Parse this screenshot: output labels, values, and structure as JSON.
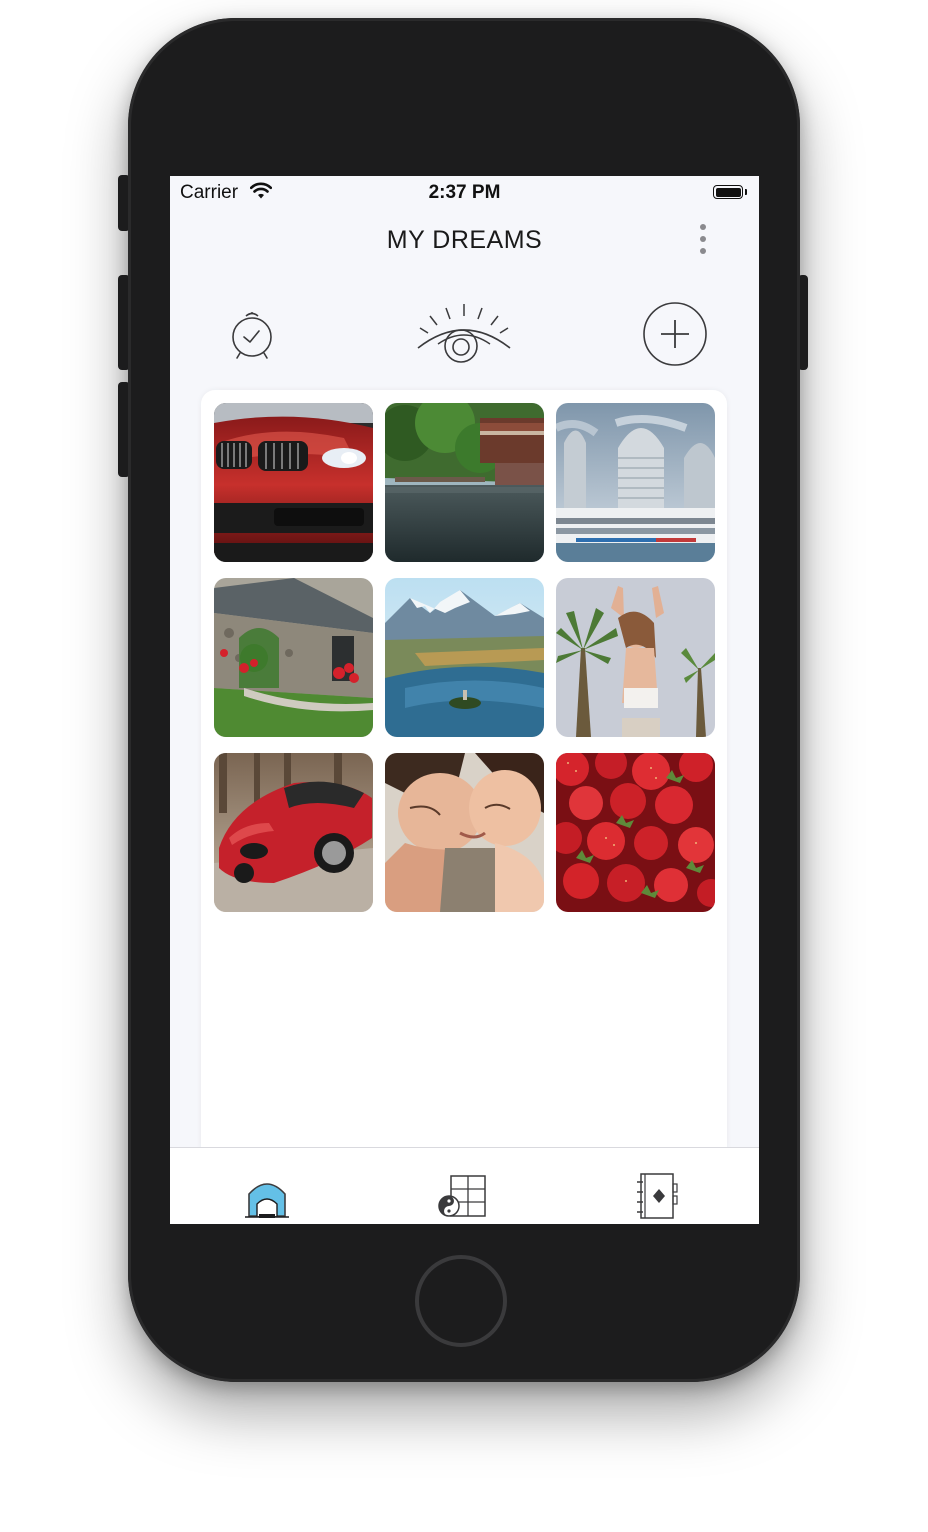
{
  "status_bar": {
    "carrier": "Carrier",
    "time": "2:37 PM",
    "wifi_icon": "wifi-icon",
    "battery_icon": "battery-icon"
  },
  "nav": {
    "title": "MY DREAMS",
    "more_icon": "more-vertical-icon"
  },
  "toolbar": {
    "alarm_icon": "alarm-clock-icon",
    "eye_icon": "eye-icon",
    "add_icon": "add-circle-icon"
  },
  "dream_images": [
    {
      "name": "red-bmw-car"
    },
    {
      "name": "lake-house"
    },
    {
      "name": "city-towers-cruise-ship"
    },
    {
      "name": "stone-cottage-flowers"
    },
    {
      "name": "mountain-lake-island"
    },
    {
      "name": "woman-stretching-palms"
    },
    {
      "name": "red-sports-car"
    },
    {
      "name": "couple-embracing"
    },
    {
      "name": "strawberries"
    }
  ],
  "tab_bar": {
    "tabs": [
      {
        "icon": "home-icon",
        "active": true
      },
      {
        "icon": "vision-board-icon",
        "active": false
      },
      {
        "icon": "journal-icon",
        "active": false
      }
    ],
    "accent_color": "#49b6e3"
  }
}
